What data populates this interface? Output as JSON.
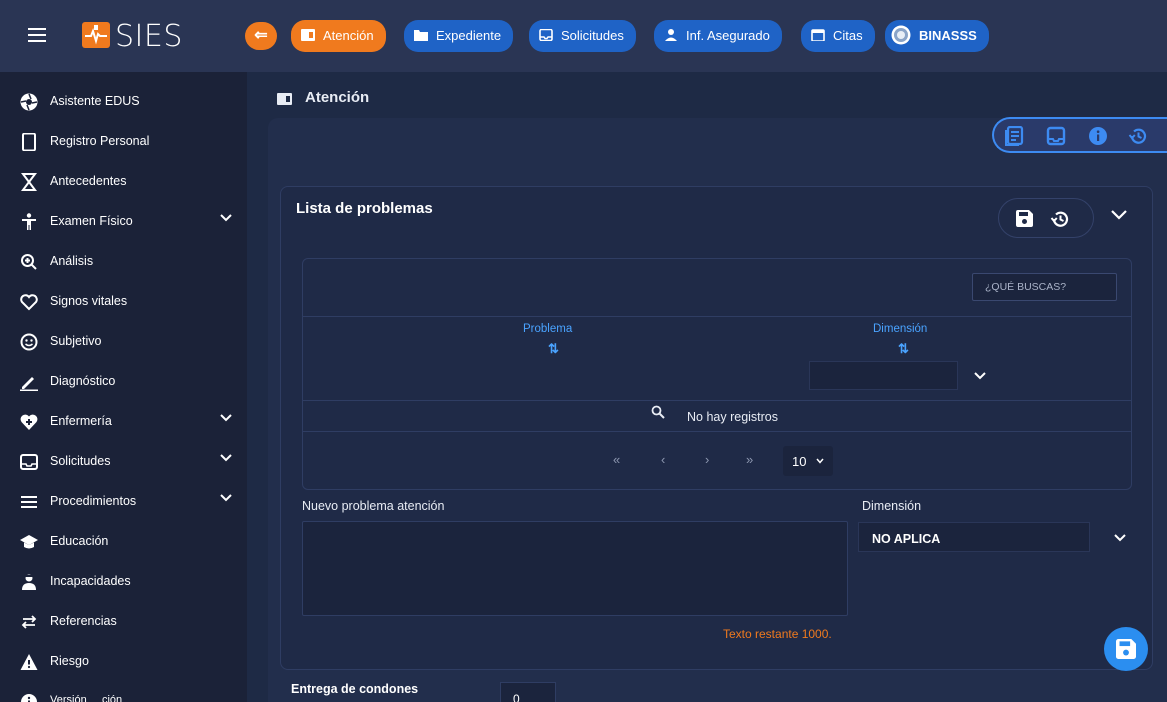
{
  "app": {
    "name": "SIES"
  },
  "nav": {
    "tabs": [
      {
        "label": "Atención",
        "icon": "card-icon",
        "active": true
      },
      {
        "label": "Expediente",
        "icon": "folder-icon"
      },
      {
        "label": "Solicitudes",
        "icon": "inbox-icon"
      },
      {
        "label": "Inf. Asegurado",
        "icon": "person-icon"
      },
      {
        "label": "Citas",
        "icon": "calendar-icon"
      },
      {
        "label": "BINASSS",
        "icon": "seal-icon"
      }
    ]
  },
  "sidebar": {
    "items": [
      {
        "label": "Asistente EDUS",
        "icon": "aperture-icon"
      },
      {
        "label": "Registro Personal",
        "icon": "tablet-icon"
      },
      {
        "label": "Antecedentes",
        "icon": "hourglass-icon"
      },
      {
        "label": "Examen Físico",
        "icon": "person-standing-icon",
        "expandable": true
      },
      {
        "label": "Análisis",
        "icon": "zoom-in-icon"
      },
      {
        "label": "Signos vitales",
        "icon": "heart-icon"
      },
      {
        "label": "Subjetivo",
        "icon": "smiley-icon"
      },
      {
        "label": "Diagnóstico",
        "icon": "pencil-icon"
      },
      {
        "label": "Enfermería",
        "icon": "heart-plus-icon",
        "expandable": true
      },
      {
        "label": "Solicitudes",
        "icon": "inbox-icon",
        "expandable": true
      },
      {
        "label": "Procedimientos",
        "icon": "list-icon",
        "expandable": true
      },
      {
        "label": "Educación",
        "icon": "graduation-cap-icon"
      },
      {
        "label": "Incapacidades",
        "icon": "medical-person-icon"
      },
      {
        "label": "Referencias",
        "icon": "swap-arrows-icon"
      },
      {
        "label": "Riesgo",
        "icon": "warning-icon"
      },
      {
        "label": "Versión     ción",
        "icon": "info-icon"
      }
    ]
  },
  "page": {
    "title": "Atención"
  },
  "problems": {
    "title": "Lista de problemas",
    "search_placeholder": "¿QUÉ BUSCAS?",
    "columns": [
      "Problema",
      "Dimensión"
    ],
    "empty_text": "No hay registros",
    "pagination": {
      "first": "«",
      "prev": "‹",
      "next": "›",
      "last": "»",
      "page_size": "10"
    }
  },
  "new_problem": {
    "label": "Nuevo problema atención",
    "value": "",
    "remaining": "Texto restante 1000.",
    "dimension_label": "Dimensión",
    "dimension_value": "NO APLICA"
  },
  "condones": {
    "label": "Entrega de condones",
    "value": "0"
  },
  "colors": {
    "accent": "#f07a1e",
    "primary": "#1f63c6",
    "link": "#4aa3ff",
    "background": "#1e2a45"
  }
}
